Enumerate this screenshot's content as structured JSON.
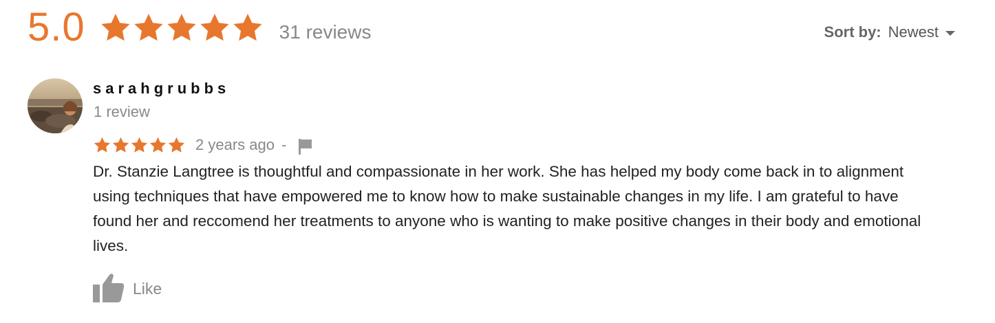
{
  "summary": {
    "rating": "5.0",
    "stars": 5,
    "review_count": "31 reviews"
  },
  "sort": {
    "label": "Sort by:",
    "value": "Newest"
  },
  "review": {
    "name": "sarahgrubbs",
    "reviewer_reviews": "1 review",
    "stars": 5,
    "date": "2 years ago",
    "separator": "-",
    "text": "Dr. Stanzie Langtree is thoughtful and compassionate in her work. She has helped my body come back in to alignment using techniques that have empowered me to know how to make sustainable changes in my life. I am grateful to have found her and reccomend her treatments to anyone who is wanting to make positive changes in their body and emotional lives.",
    "like_label": "Like",
    "avatar_icon": "user-photo",
    "flag_icon": "flag-icon",
    "like_icon": "thumbs-up-icon"
  },
  "colors": {
    "star": "#e8772e",
    "muted": "#888888",
    "text": "#222222"
  }
}
